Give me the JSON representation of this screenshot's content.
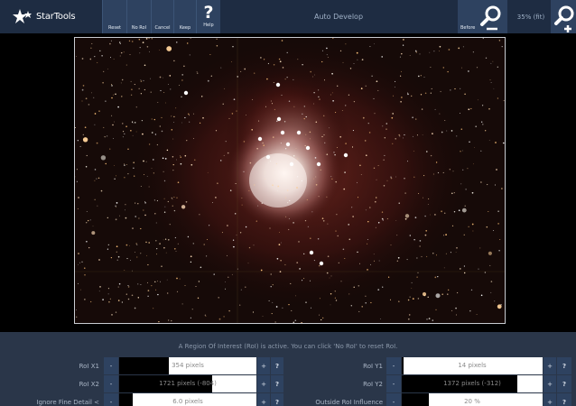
{
  "toolbar": {
    "logo_text": "StarTools",
    "buttons": [
      "Reset",
      "No RoI",
      "Cancel",
      "Keep"
    ],
    "help_label": "Help",
    "help_symbol": "?",
    "title": "Auto Develop",
    "before_label": "Before",
    "zoom_text": "35% (fit)"
  },
  "status_message": "A Region Of Interest (RoI) is active. You can click 'No RoI' to reset RoI.",
  "controls": {
    "minus": "-",
    "plus": "+",
    "help": "?",
    "rows": [
      [
        {
          "label": "RoI X1",
          "value": "354 pixels",
          "fill": 0.36
        },
        {
          "label": "RoI Y1",
          "value": "14 pixels",
          "fill": 0.01
        }
      ],
      [
        {
          "label": "RoI X2",
          "value": "1721 pixels (-804)",
          "fill": 0.68
        },
        {
          "label": "RoI Y2",
          "value": "1372 pixels (-312)",
          "fill": 0.82
        }
      ],
      [
        {
          "label": "Ignore Fine Detail <",
          "value": "6.0 pixels",
          "fill": 0.1
        },
        {
          "label": "Outside RoI Influence",
          "value": "20 %",
          "fill": 0.19
        }
      ]
    ]
  },
  "colors": {
    "toolbar_bg": "#1e2c42",
    "button_bg": "#2e4260",
    "panel_bg": "#2a3649",
    "slider_bg": "#ffffff",
    "slider_fill": "#000000"
  }
}
